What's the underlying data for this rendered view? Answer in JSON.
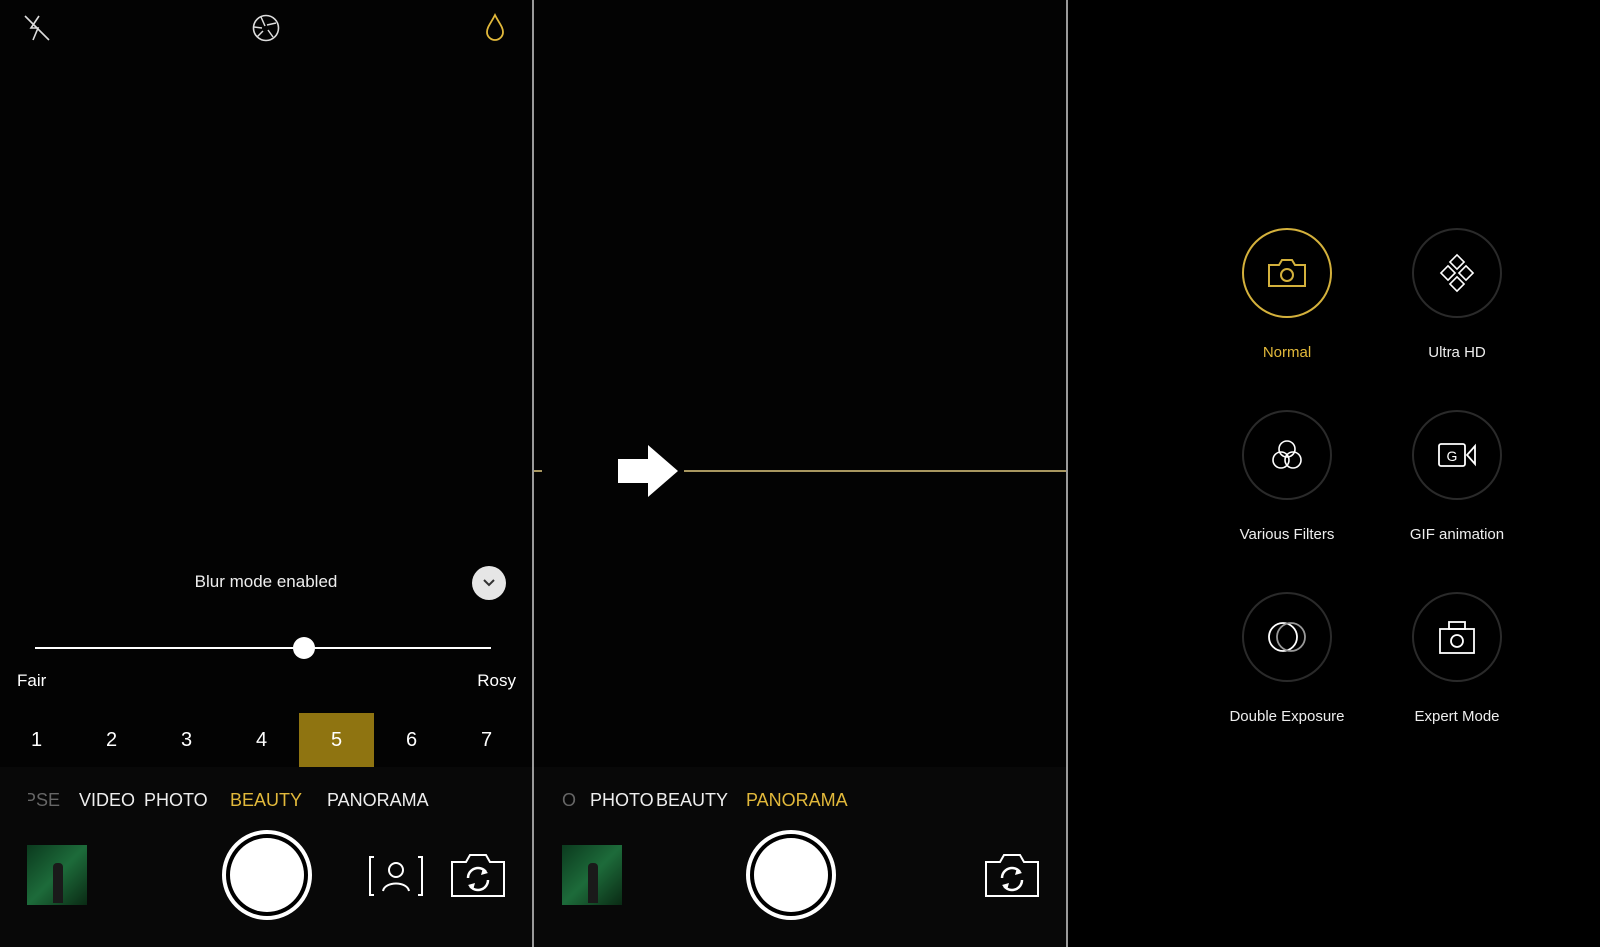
{
  "accent_color": "#e2b93b",
  "beauty_panel": {
    "top_icons": [
      "flash-off-icon",
      "aperture-icon",
      "drop-icon"
    ],
    "blur_status": "Blur mode enabled",
    "slider": {
      "min_label": "Fair",
      "max_label": "Rosy",
      "value_fraction": 0.59
    },
    "levels": [
      "1",
      "2",
      "3",
      "4",
      "5",
      "6",
      "7"
    ],
    "selected_level": "5",
    "modes": [
      "LAPSE",
      "VIDEO",
      "PHOTO",
      "BEAUTY",
      "PANORAMA"
    ],
    "active_mode": "BEAUTY"
  },
  "panorama_panel": {
    "modes": [
      "EO",
      "PHOTO",
      "BEAUTY",
      "PANORAMA"
    ],
    "active_mode": "PANORAMA"
  },
  "photo_modes": {
    "items": [
      {
        "label": "Normal",
        "icon": "camera-icon",
        "active": true
      },
      {
        "label": "Ultra HD",
        "icon": "ultra-hd-icon",
        "active": false
      },
      {
        "label": "Various Filters",
        "icon": "filters-icon",
        "active": false
      },
      {
        "label": "GIF animation",
        "icon": "gif-icon",
        "active": false
      },
      {
        "label": "Double Exposure",
        "icon": "double-exposure-icon",
        "active": false
      },
      {
        "label": "Expert Mode",
        "icon": "expert-camera-icon",
        "active": false
      }
    ]
  }
}
